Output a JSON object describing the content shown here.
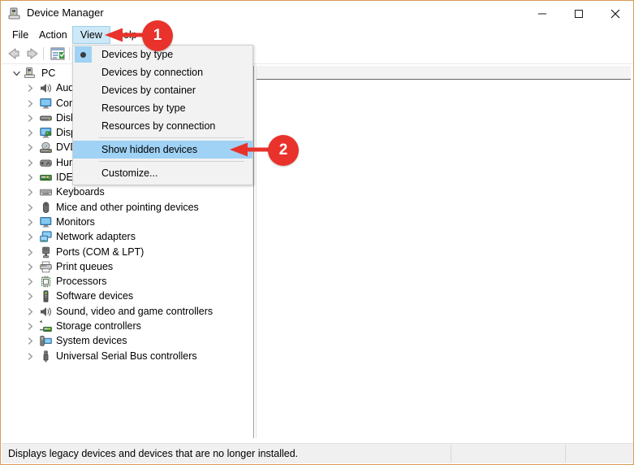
{
  "window": {
    "title": "Device Manager",
    "icon": "device-manager-icon",
    "border_color": "#d79b56",
    "controls": {
      "minimize": "Minimize",
      "maximize": "Maximize",
      "close": "Close"
    }
  },
  "menubar": {
    "items": [
      {
        "label": "File",
        "active": false
      },
      {
        "label": "Action",
        "active": false
      },
      {
        "label": "View",
        "active": true
      },
      {
        "label": "Help",
        "active": false
      }
    ]
  },
  "toolbar": {
    "buttons": [
      {
        "name": "back-button",
        "label": "Back"
      },
      {
        "name": "forward-button",
        "label": "Forward"
      },
      {
        "name": "properties-button",
        "label": "Properties"
      }
    ]
  },
  "view_menu": {
    "items": [
      {
        "label": "Devices by type",
        "selected_radio": true,
        "highlighted": false
      },
      {
        "label": "Devices by connection",
        "selected_radio": false,
        "highlighted": false
      },
      {
        "label": "Devices by container",
        "selected_radio": false,
        "highlighted": false
      },
      {
        "label": "Resources by type",
        "selected_radio": false,
        "highlighted": false
      },
      {
        "label": "Resources by connection",
        "selected_radio": false,
        "highlighted": false
      },
      {
        "label": "Show hidden devices",
        "selected_radio": false,
        "highlighted": true
      },
      {
        "label": "Customize...",
        "selected_radio": false,
        "highlighted": false
      }
    ],
    "highlight_color": "#9fd2f5"
  },
  "tree": {
    "root": {
      "label": "PC",
      "icon": "computer-icon",
      "expanded": true
    },
    "nodes": [
      {
        "label": "Audio inputs and outputs",
        "icon": "speaker-icon"
      },
      {
        "label": "Computer",
        "icon": "monitor-icon"
      },
      {
        "label": "Disk drives",
        "icon": "disk-icon"
      },
      {
        "label": "Display adapters",
        "icon": "display-adapter-icon"
      },
      {
        "label": "DVD/CD-ROM drives",
        "icon": "dvd-icon"
      },
      {
        "label": "Human Interface Devices",
        "icon": "hid-icon"
      },
      {
        "label": "IDE ATA/ATAPI controllers",
        "icon": "ide-controller-icon"
      },
      {
        "label": "Keyboards",
        "icon": "keyboard-icon"
      },
      {
        "label": "Mice and other pointing devices",
        "icon": "mouse-icon"
      },
      {
        "label": "Monitors",
        "icon": "monitor-icon"
      },
      {
        "label": "Network adapters",
        "icon": "network-adapter-icon"
      },
      {
        "label": "Ports (COM & LPT)",
        "icon": "port-icon"
      },
      {
        "label": "Print queues",
        "icon": "printer-icon"
      },
      {
        "label": "Processors",
        "icon": "processor-icon"
      },
      {
        "label": "Software devices",
        "icon": "software-device-icon"
      },
      {
        "label": "Sound, video and game controllers",
        "icon": "speaker-icon"
      },
      {
        "label": "Storage controllers",
        "icon": "storage-controller-icon"
      },
      {
        "label": "System devices",
        "icon": "system-device-icon"
      },
      {
        "label": "Universal Serial Bus controllers",
        "icon": "usb-icon"
      }
    ]
  },
  "statusbar": {
    "message": "Displays legacy devices and devices that are no longer installed.",
    "panel2": "",
    "panel3": ""
  },
  "annotations": {
    "color": "#e8322b",
    "callouts": [
      {
        "number": "1",
        "points_to": "View menu"
      },
      {
        "number": "2",
        "points_to": "Show hidden devices"
      }
    ]
  }
}
